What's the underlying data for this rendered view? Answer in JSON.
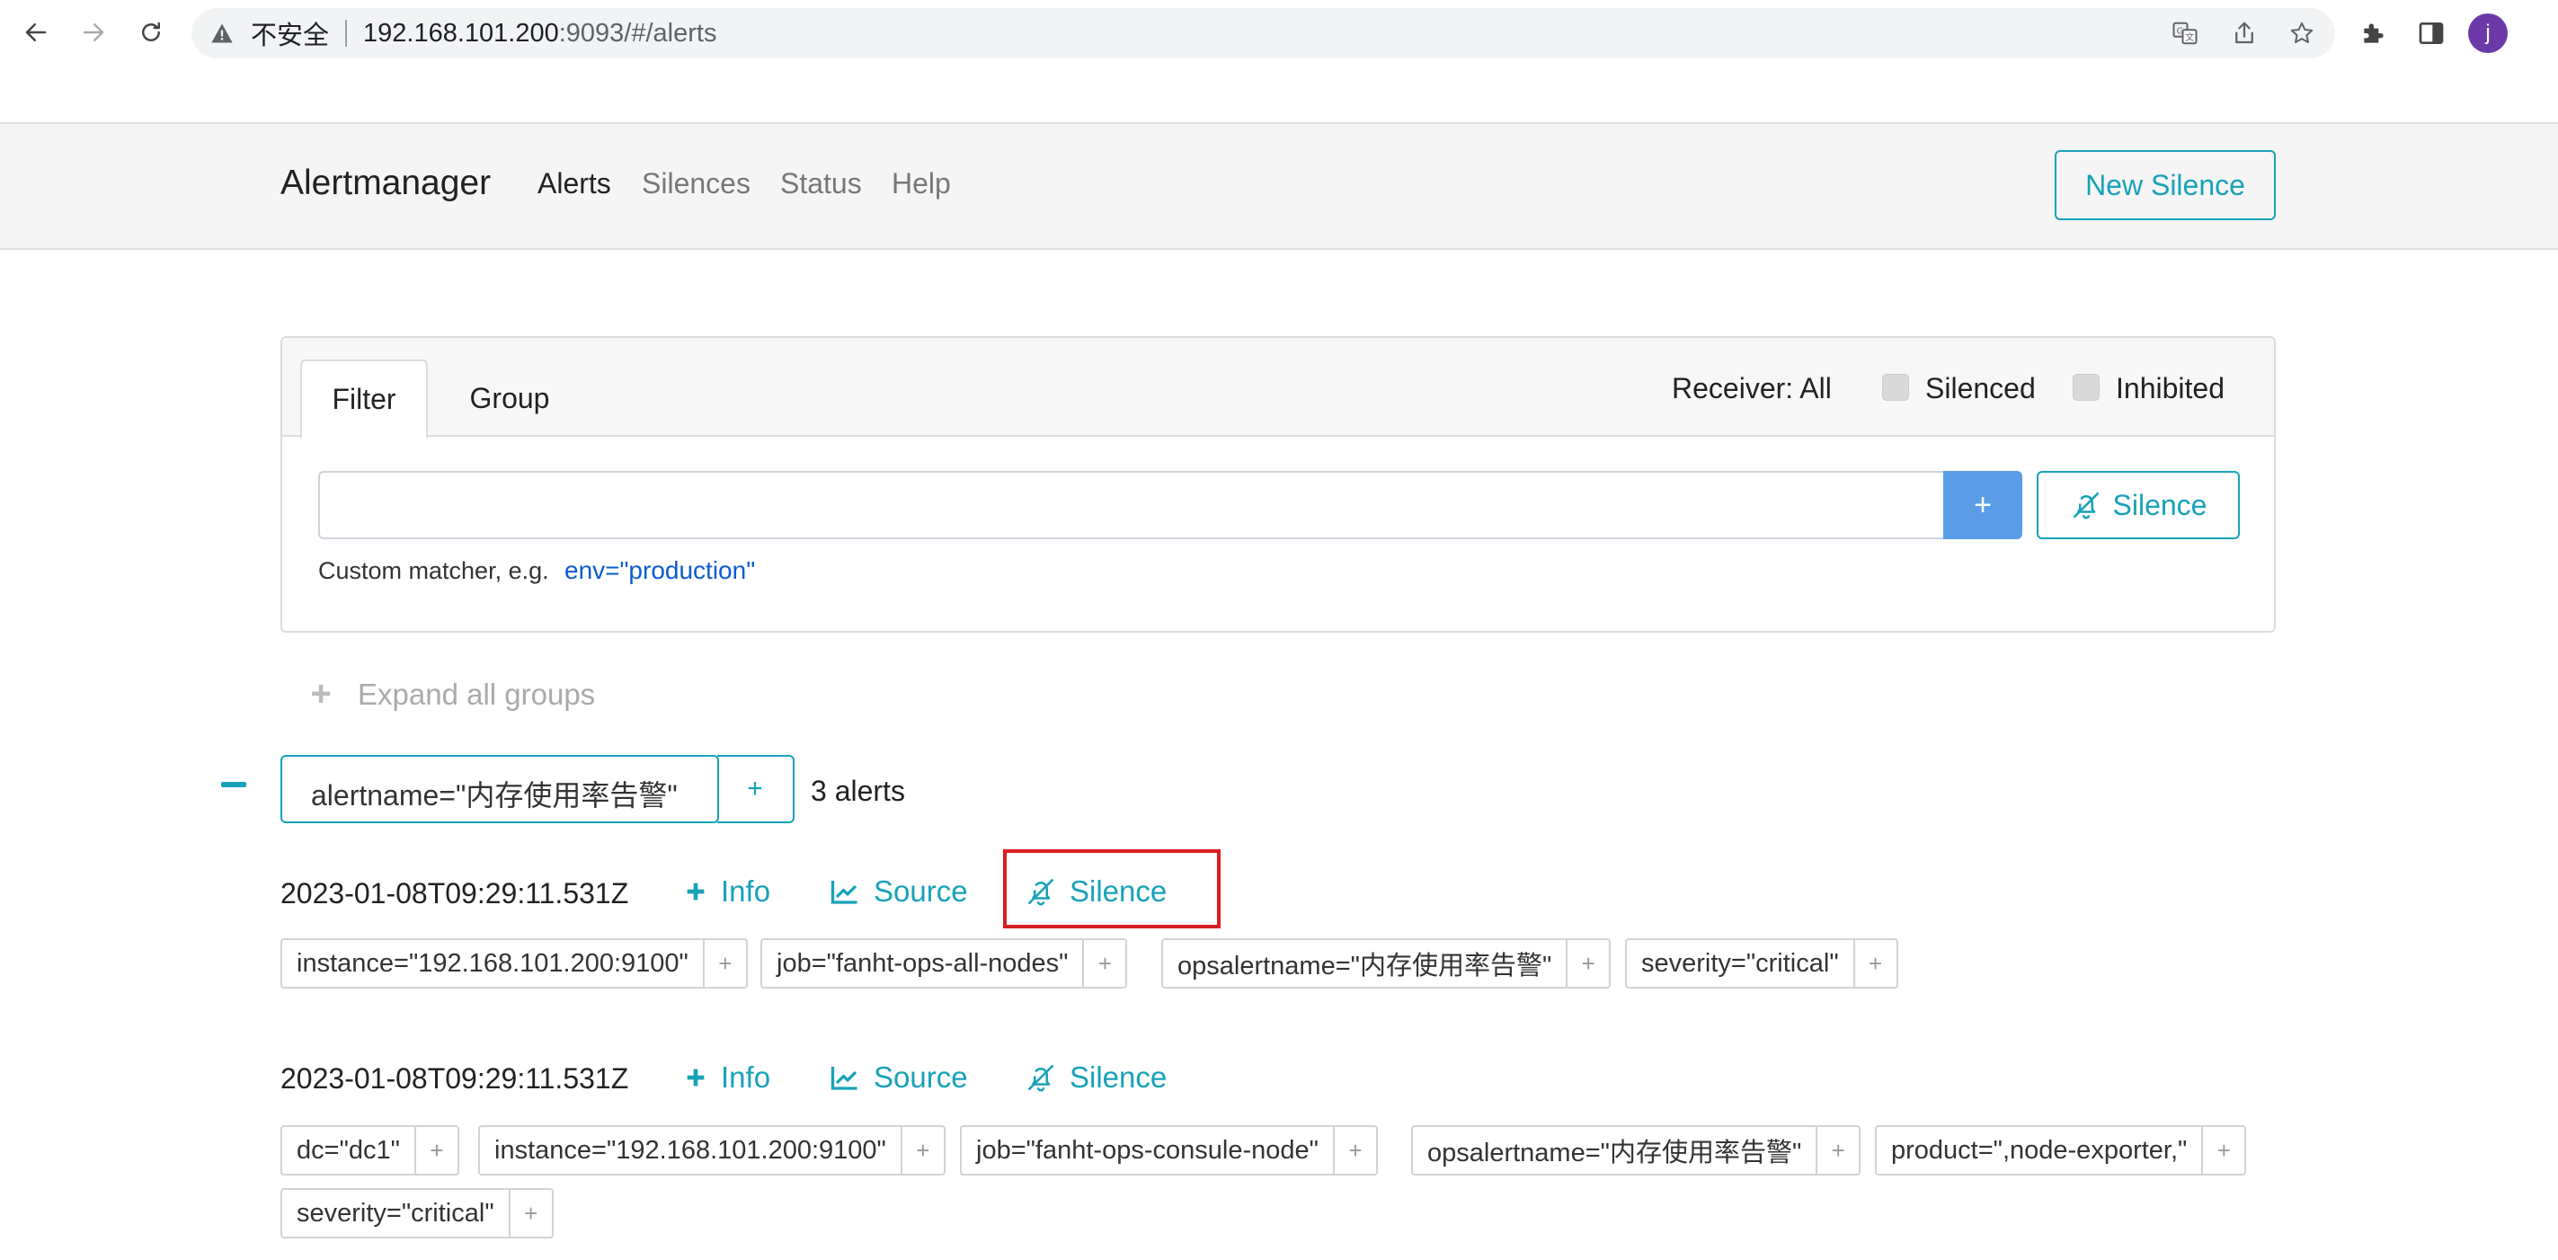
{
  "browser": {
    "insecure_label": "不安全",
    "url_host": "192.168.101.200",
    "url_rest": ":9093/#/alerts",
    "profile_initial": "j"
  },
  "navbar": {
    "brand": "Alertmanager",
    "links": [
      "Alerts",
      "Silences",
      "Status",
      "Help"
    ],
    "active_link": "Alerts",
    "new_silence_label": "New Silence"
  },
  "filter_card": {
    "tabs": [
      "Filter",
      "Group"
    ],
    "receiver_label": "Receiver: All",
    "silenced_label": "Silenced",
    "inhibited_label": "Inhibited",
    "input_value": "",
    "add_label": "+",
    "silence_label": "Silence",
    "hint": "Custom matcher, e.g.",
    "hint_example": "env=\"production\""
  },
  "expand_all": {
    "icon": "+",
    "label": "Expand all groups"
  },
  "group": {
    "collapse_icon": "minus-icon",
    "label": "alertname=\"内存使用率告警\"",
    "add_label": "+",
    "count": "3 alerts"
  },
  "alerts": [
    {
      "time": "2023-01-08T09:29:11.531Z",
      "info_label": "Info",
      "source_label": "Source",
      "silence_label": "Silence",
      "labels": [
        "instance=\"192.168.101.200:9100\"",
        "job=\"fanht-ops-all-nodes\"",
        "opsalertname=\"内存使用率告警\"",
        "severity=\"critical\""
      ]
    },
    {
      "time": "2023-01-08T09:29:11.531Z",
      "info_label": "Info",
      "source_label": "Source",
      "silence_label": "Silence",
      "labels": [
        "dc=\"dc1\"",
        "instance=\"192.168.101.200:9100\"",
        "job=\"fanht-ops-consule-node\"",
        "opsalertname=\"内存使用率告警\"",
        "product=\",node-exporter,\"",
        "severity=\"critical\""
      ]
    }
  ],
  "label_add": "+",
  "colors": {
    "accent": "#17a2b8",
    "primary_button": "#5b9ce6",
    "highlight": "#d71f1f"
  }
}
